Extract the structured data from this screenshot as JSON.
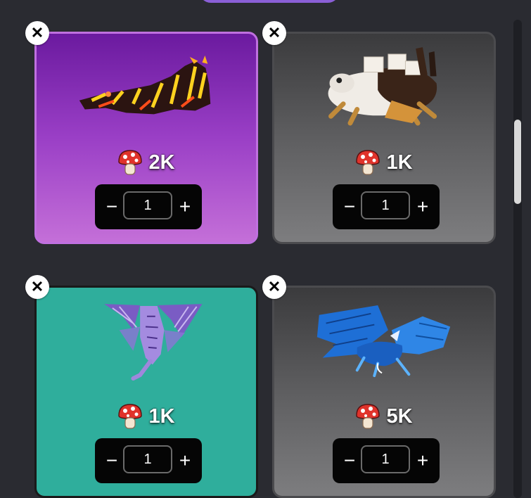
{
  "header": {
    "tab_color": "#8a5fd6"
  },
  "cards": [
    {
      "price": "2K",
      "quantity": "1",
      "minus_label": "−",
      "plus_label": "+",
      "close_label": "✕",
      "background": "purple",
      "pet": "fire-dragon"
    },
    {
      "price": "1K",
      "quantity": "1",
      "minus_label": "−",
      "plus_label": "+",
      "close_label": "✕",
      "background": "grey",
      "pet": "cake-crab"
    },
    {
      "price": "1K",
      "quantity": "1",
      "minus_label": "−",
      "plus_label": "+",
      "close_label": "✕",
      "background": "teal",
      "pet": "purple-dragon"
    },
    {
      "price": "5K",
      "quantity": "1",
      "minus_label": "−",
      "plus_label": "+",
      "close_label": "✕",
      "background": "grey",
      "pet": "blue-griffin"
    }
  ],
  "icons": {
    "price_icon": "mushroom-icon",
    "remove_icon": "close-icon"
  }
}
